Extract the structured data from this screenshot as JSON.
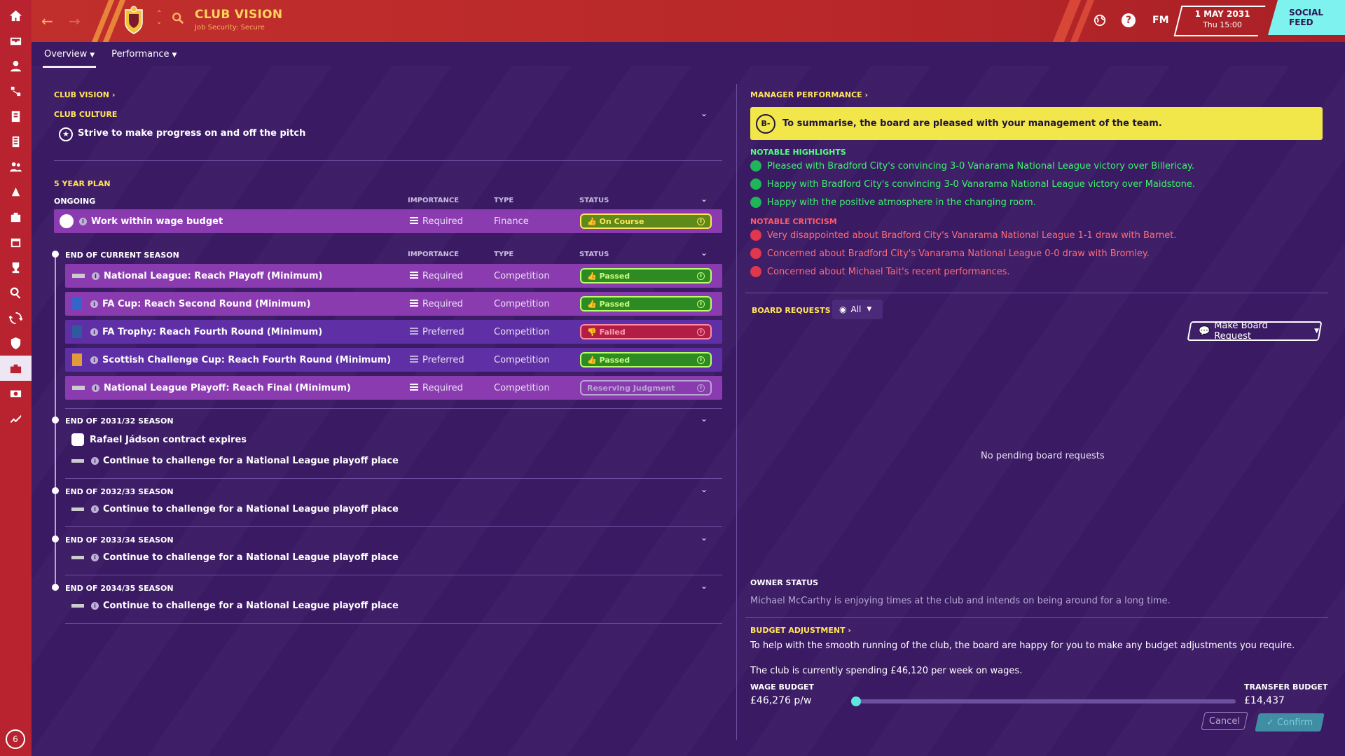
{
  "sidebar": {
    "badge": "6"
  },
  "header": {
    "title": "CLUB VISION",
    "subtitle": "Job Security: Secure",
    "fm": "FM",
    "date": "1 MAY 2031",
    "time": "Thu 15:00",
    "social": "SOCIAL FEED"
  },
  "tabs": [
    {
      "label": "Overview"
    },
    {
      "label": "Performance"
    }
  ],
  "left": {
    "club_vision": "CLUB VISION",
    "club_culture": "CLUB CULTURE",
    "culture_text": "Strive to make progress on and off the pitch",
    "plan_title": "5 YEAR PLAN",
    "ongoing": "ONGOING",
    "col_importance": "IMPORTANCE",
    "col_type": "TYPE",
    "col_status": "STATUS",
    "ongoing_row": {
      "text": "Work within wage budget",
      "importance": "Required",
      "type": "Finance",
      "status": "On Course"
    },
    "current_season": "END OF CURRENT SEASON",
    "current_rows": [
      {
        "text": "National League: Reach Playoff (Minimum)",
        "importance": "Required",
        "type": "Competition",
        "status": "Passed"
      },
      {
        "text": "FA Cup: Reach Second Round (Minimum)",
        "importance": "Required",
        "type": "Competition",
        "status": "Passed"
      },
      {
        "text": "FA Trophy: Reach Fourth Round (Minimum)",
        "importance": "Preferred",
        "type": "Competition",
        "status": "Failed"
      },
      {
        "text": "Scottish Challenge Cup: Reach Fourth Round (Minimum)",
        "importance": "Preferred",
        "type": "Competition",
        "status": "Passed"
      },
      {
        "text": "National League Playoff: Reach Final (Minimum)",
        "importance": "Required",
        "type": "Competition",
        "status": "Reserving Judgment"
      }
    ],
    "s1": "END OF 2031/32 SEASON",
    "s1_items": [
      "Rafael Jádson contract expires",
      "Continue to challenge for a National League playoff place"
    ],
    "s2": "END OF 2032/33 SEASON",
    "s2_item": "Continue to challenge for a National League playoff place",
    "s3": "END OF 2033/34 SEASON",
    "s3_item": "Continue to challenge for a National League playoff place",
    "s4": "END OF 2034/35 SEASON",
    "s4_item": "Continue to challenge for a National League playoff place"
  },
  "right": {
    "mp_title": "MANAGER PERFORMANCE",
    "grade": "B-",
    "summary": "To summarise, the board are pleased with your management of the team.",
    "highlights_title": "NOTABLE HIGHLIGHTS",
    "highlights": [
      "Pleased with Bradford City's convincing 3-0 Vanarama National League victory over Billericay.",
      "Happy with Bradford City's convincing 3-0 Vanarama National League victory over Maidstone.",
      "Happy with the positive atmosphere in the changing room."
    ],
    "criticism_title": "NOTABLE CRITICISM",
    "criticism": [
      "Very disappointed about Bradford City's Vanarama National League 1-1 draw with Barnet.",
      "Concerned about Bradford City's Vanarama National League 0-0 draw with Bromley.",
      "Concerned about Michael Tait's recent performances."
    ],
    "board_requests": "BOARD REQUESTS",
    "filter": "All",
    "make_request": "Make Board Request",
    "no_requests": "No pending board requests",
    "owner_title": "OWNER STATUS",
    "owner_text": "Michael McCarthy is enjoying times at the club and intends on being around for a long time.",
    "budget_title": "BUDGET ADJUSTMENT",
    "budget_text": "To help with the smooth running of the club, the board are happy for you to make any budget adjustments you require.",
    "spending": "The club is currently spending £46,120 per week on wages.",
    "wage_label": "WAGE BUDGET",
    "wage_value": "£46,276 p/w",
    "transfer_label": "TRANSFER BUDGET",
    "transfer_value": "£14,437",
    "slider_fraction": 0.0,
    "cancel": "Cancel",
    "confirm": "Confirm"
  }
}
